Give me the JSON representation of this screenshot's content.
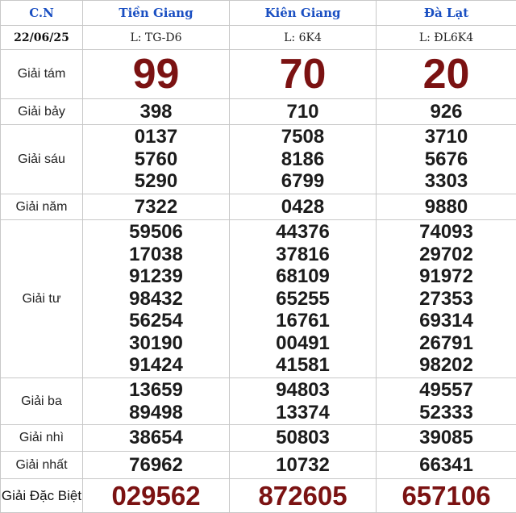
{
  "header": {
    "day": "C.N",
    "date": "22/06/25",
    "provinces": [
      {
        "name": "Tiền Giang",
        "ticket": "L: TG-D6"
      },
      {
        "name": "Kiên Giang",
        "ticket": "L: 6K4"
      },
      {
        "name": "Đà Lạt",
        "ticket": "L: ĐL6K4"
      }
    ]
  },
  "prizes": {
    "tam": {
      "label": "Giải tám",
      "values": [
        [
          "99"
        ],
        [
          "70"
        ],
        [
          "20"
        ]
      ]
    },
    "bay": {
      "label": "Giải bảy",
      "values": [
        [
          "398"
        ],
        [
          "710"
        ],
        [
          "926"
        ]
      ]
    },
    "sau": {
      "label": "Giải sáu",
      "values": [
        [
          "0137",
          "5760",
          "5290"
        ],
        [
          "7508",
          "8186",
          "6799"
        ],
        [
          "3710",
          "5676",
          "3303"
        ]
      ]
    },
    "nam": {
      "label": "Giải năm",
      "values": [
        [
          "7322"
        ],
        [
          "0428"
        ],
        [
          "9880"
        ]
      ]
    },
    "tu": {
      "label": "Giải tư",
      "values": [
        [
          "59506",
          "17038",
          "91239",
          "98432",
          "56254",
          "30190",
          "91424"
        ],
        [
          "44376",
          "37816",
          "68109",
          "65255",
          "16761",
          "00491",
          "41581"
        ],
        [
          "74093",
          "29702",
          "91972",
          "27353",
          "69314",
          "26791",
          "98202"
        ]
      ]
    },
    "ba": {
      "label": "Giải ba",
      "values": [
        [
          "13659",
          "89498"
        ],
        [
          "94803",
          "13374"
        ],
        [
          "49557",
          "52333"
        ]
      ]
    },
    "nhi": {
      "label": "Giải nhì",
      "values": [
        [
          "38654"
        ],
        [
          "50803"
        ],
        [
          "39085"
        ]
      ]
    },
    "nhat": {
      "label": "Giải nhất",
      "values": [
        [
          "76962"
        ],
        [
          "10732"
        ],
        [
          "66341"
        ]
      ]
    },
    "db": {
      "label": "Giải Đặc Biệt",
      "values": [
        [
          "029562"
        ],
        [
          "872605"
        ],
        [
          "657106"
        ]
      ]
    }
  },
  "colors": {
    "header_text": "#1a4fc2",
    "accent_red": "#7b1212",
    "number_text": "#1c1c1c",
    "grid_line": "#c8c8c8"
  }
}
